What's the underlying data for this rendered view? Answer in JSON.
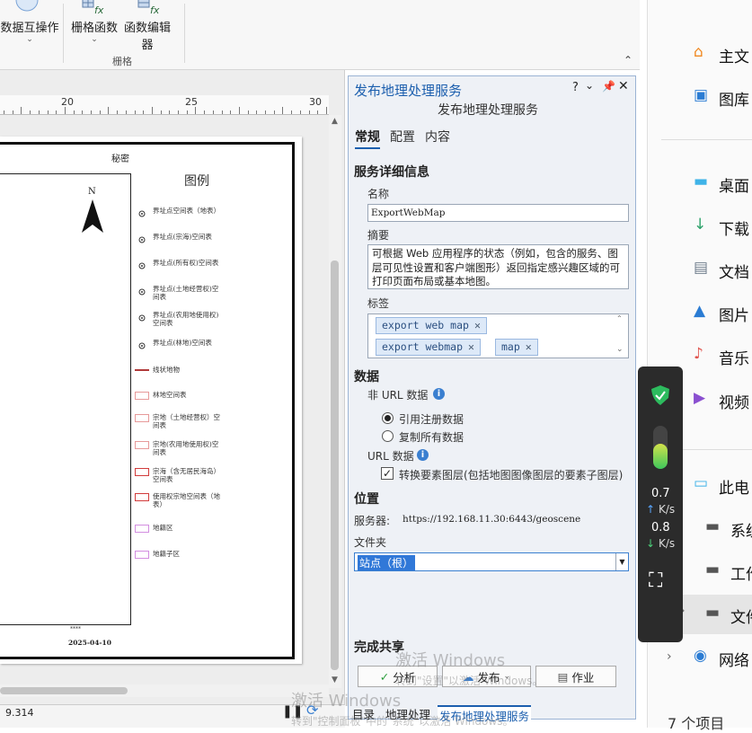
{
  "ribbon": {
    "data_interop": "数据互操作",
    "raster_functions": "栅格函数",
    "function_editor": "函数编辑器",
    "group_label": "栅格"
  },
  "ruler": {
    "labels": [
      "20",
      "25",
      "30"
    ]
  },
  "layout": {
    "header": "秘密",
    "legend_title": "图例",
    "north": "N",
    "date": "2025-04-10",
    "scale_text": "****",
    "legend_items": [
      "界址点空间表（地表）",
      "界址点(宗海)空间表",
      "界址点(所有权)空间表",
      "界址点(土地经营权)空间表",
      "界址点(农用地使用权)空间表",
      "界址点(林地)空间表",
      "线状地物",
      "林地空间表",
      "宗地（土地经营权）空间表",
      "宗地(农用地使用权)空间表",
      "宗海（含无居民海岛）空间表",
      "使用权宗地空间表（地表）",
      "地籍区",
      "地籍子区"
    ]
  },
  "status": {
    "scale": "9.314"
  },
  "pane": {
    "title": "发布地理处理服务",
    "subtitle": "发布地理处理服务",
    "help": "?",
    "tabs": [
      "常规",
      "配置",
      "内容"
    ],
    "details_heading": "服务详细信息",
    "name_label": "名称",
    "name_value": "ExportWebMap",
    "summary_label": "摘要",
    "summary_value": "可根据 Web 应用程序的状态（例如，包含的服务、图层可见性设置和客户端图形）返回指定感兴趣区域的可打印页面布局或基本地图。",
    "tags_label": "标签",
    "tags": [
      "export web map",
      "export webmap",
      "map"
    ],
    "data_heading": "数据",
    "non_url_label": "非 URL 数据",
    "radio_register": "引用注册数据",
    "radio_copy": "复制所有数据",
    "url_label": "URL 数据",
    "convert_label": "转换要素图层(包括地图图像图层的要素子图层)",
    "location_heading": "位置",
    "server_label": "服务器:",
    "server_value": "https://192.168.11.30:6443/geoscene",
    "folder_label": "文件夹",
    "folder_value": "站点（根）",
    "finish_heading": "完成共享",
    "analyze_btn": "分析",
    "publish_btn": "发布",
    "jobs_btn": "作业"
  },
  "bottom_tabs": [
    "目录",
    "地理处理",
    "发布地理处理服务"
  ],
  "watermark": {
    "line1": "激活 Windows",
    "line2": "转到\"设置\"以激活 Windows。",
    "line3": "转到\"控制面板\"中的\"系统\"以激活 Windows。"
  },
  "widget": {
    "up_value": "0.7",
    "up_unit": "K/s",
    "down_value": "0.8",
    "down_unit": "K/s"
  },
  "explorer": {
    "items": [
      "主文",
      "图库",
      "桌面",
      "下载",
      "文档",
      "图片",
      "音乐",
      "视频",
      "此电",
      "系统",
      "工作",
      "文件",
      "网络"
    ],
    "count": "7 个项目"
  }
}
